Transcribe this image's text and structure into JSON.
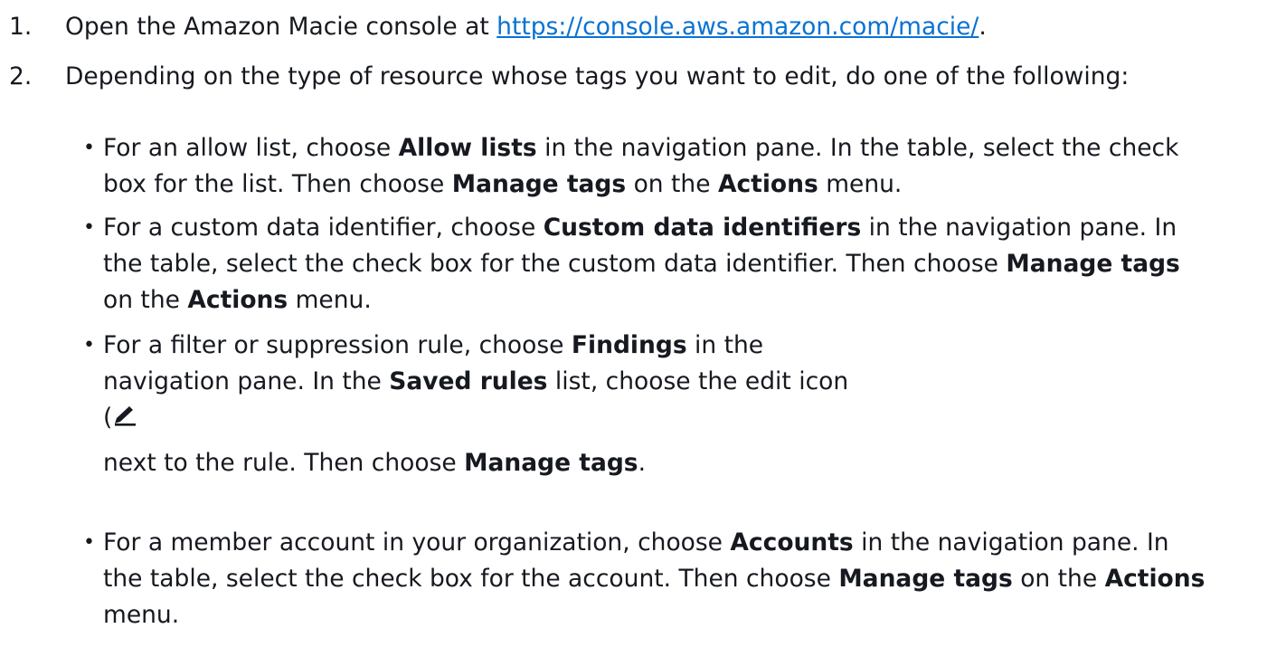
{
  "steps": [
    {
      "number": "1.",
      "text_before": "Open the Amazon Macie console at ",
      "link": "https://console.aws.amazon.com/macie/",
      "text_after": "."
    },
    {
      "number": "2.",
      "text": "Depending on the type of resource whose tags you want to edit, do one of the following:"
    }
  ],
  "bullets": {
    "b1": {
      "l1_a": "For an allow list, choose ",
      "l1_b": "Allow lists",
      "l1_c": " in the navigation pane. In the table, select the check",
      "l2_a": "box for the list. Then choose ",
      "l2_b": "Manage tags",
      "l2_c": " on the ",
      "l2_d": "Actions",
      "l2_e": " menu."
    },
    "b2": {
      "l1_a": "For a custom data identifier, choose ",
      "l1_b": "Custom data identifiers",
      "l1_c": " in the navigation pane. In",
      "l2_a": "the table, select the check box for the custom data identifier. Then choose ",
      "l2_b": "Manage tags",
      "l3_a": "on the ",
      "l3_b": "Actions",
      "l3_c": " menu."
    },
    "b3": {
      "l1_a": "For a filter or suppression rule, choose ",
      "l1_b": "Findings",
      "l1_c": " in the",
      "l2_a": "navigation pane. In the ",
      "l2_b": "Saved rules",
      "l2_c": " list, choose the edit icon",
      "l3_a": "(",
      "l4_a": "next to the rule. Then choose ",
      "l4_b": "Manage tags",
      "l4_c": "."
    },
    "b4": {
      "l1_a": "For a member account in your organization, choose ",
      "l1_b": "Accounts",
      "l1_c": " in the navigation pane. In",
      "l2_a": "the table, select the check box for the account. Then choose ",
      "l2_b": "Manage tags",
      "l2_c": " on the ",
      "l2_d": "Actions",
      "l3_a": "menu."
    }
  },
  "bullet_glyph": "•",
  "icons": {
    "edit": "pencil-edit-icon"
  },
  "colors": {
    "text": "#16191f",
    "link": "#0972d3"
  }
}
